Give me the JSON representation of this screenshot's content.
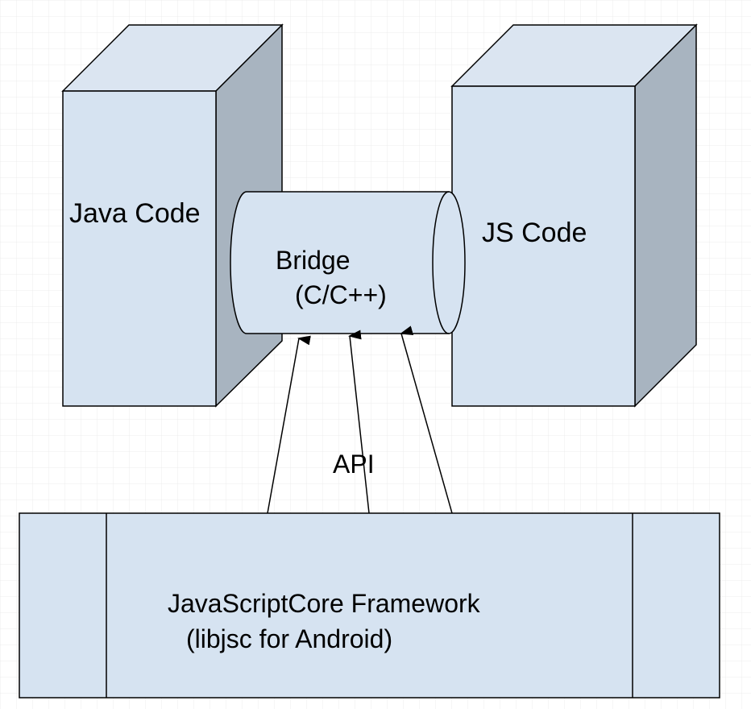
{
  "colors": {
    "background": "#ffffff",
    "grid": "#ececec",
    "box_front": "#d6e3f1",
    "box_side": "#a8b4c0",
    "box_top": "#dbe5f1",
    "outline": "#000000"
  },
  "diagram": {
    "java_code_label": "Java Code",
    "js_code_label": "JS Code",
    "bridge_label_line1": "Bridge",
    "bridge_label_line2": "(C/C++)",
    "api_label": "API",
    "framework_label_line1": "JavaScriptCore Framework",
    "framework_label_line2": "(libjsc for Android)"
  }
}
